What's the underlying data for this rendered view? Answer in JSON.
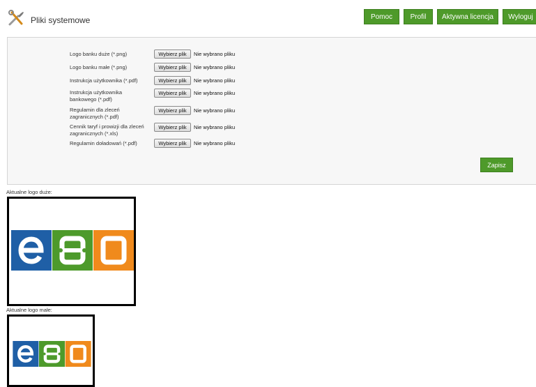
{
  "header": {
    "title": "Pliki systemowe",
    "nav": [
      {
        "label": "Pomoc"
      },
      {
        "label": "Profil"
      },
      {
        "label": "Aktywna licencja"
      },
      {
        "label": "Wyloguj"
      }
    ]
  },
  "form": {
    "rows": [
      {
        "label": "Logo banku duże (*.png)",
        "button": "Wybierz plik",
        "status": "Nie wybrano pliku"
      },
      {
        "label": "Logo banku małe (*.png)",
        "button": "Wybierz plik",
        "status": "Nie wybrano pliku"
      },
      {
        "label": "Instrukcja użytkownika (*.pdf)",
        "button": "Wybierz plik",
        "status": "Nie wybrano pliku"
      },
      {
        "label": "Instrukcja użytkownika bankowego (*.pdf)",
        "button": "Wybierz plik",
        "status": "Nie wybrano pliku"
      },
      {
        "label": "Regulamin dla zleceń zagranicznych (*.pdf)",
        "button": "Wybierz plik",
        "status": "Nie wybrano pliku"
      },
      {
        "label": "Cennik taryf i prowizji dla zleceń zagranicznych (*.xls)",
        "button": "Wybierz plik",
        "status": "Nie wybrano pliku"
      },
      {
        "label": "Regulamin doładowań (*.pdf)",
        "button": "Wybierz plik",
        "status": "Nie wybrano pliku"
      }
    ],
    "save_label": "Zapisz"
  },
  "logos": {
    "large_caption": "Aktualne logo duże:",
    "small_caption": "Aktualne logo małe:",
    "colors": {
      "blue": "#1f5fa6",
      "green": "#4d9a2b",
      "orange": "#f08a1c"
    }
  },
  "colors": {
    "accent": "#4e9a2a"
  }
}
